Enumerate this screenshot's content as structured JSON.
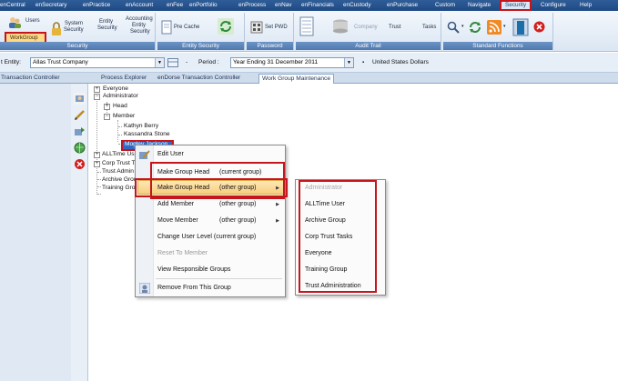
{
  "menu": {
    "tabs": [
      "enCentral",
      "enSecretary",
      "enPractice",
      "enAccount",
      "enFee",
      "enPortfolio",
      "enProcess",
      "enNav",
      "enFinancials",
      "enCustody",
      "enPurchase",
      "Custom",
      "Navigate",
      "Security",
      "Configure",
      "Help"
    ],
    "active": "Security"
  },
  "ribbon": {
    "security": {
      "title": "Security",
      "users": "Users",
      "workgroup": "WorkGroup",
      "system_security_1": "System",
      "system_security_2": "Security",
      "entity_security_1": "Entity",
      "entity_security_2": "Security",
      "accounting_1": "Accounting",
      "accounting_2": "Entity",
      "accounting_3": "Security"
    },
    "entity_security": {
      "title": "Entity Security",
      "pre_cache": "Pre Cache"
    },
    "password": {
      "title": "Password",
      "set_pwd": "Set PWD"
    },
    "audit_trail": {
      "title": "Audit Trail",
      "company": "Company",
      "trust": "Trust",
      "tasks": "Tasks"
    },
    "standard_functions": {
      "title": "Standard Functions"
    }
  },
  "entity_bar": {
    "entity_label": "t Entity:",
    "entity_value": "Allas Trust Company",
    "period_label": "Period :",
    "period_value": "Year Ending 31 December 2011",
    "currency": "United States Dollars",
    "sep": "-"
  },
  "doc_tabs": [
    "Transaction Controller",
    "Process Explorer",
    "enDorse Transaction Controller",
    "Work Group Maintenance"
  ],
  "tree": {
    "everyone": "Everyone",
    "administrator": "Administrator",
    "head": "Head",
    "member": "Member",
    "kathyn": "Kathyn Berry",
    "kassandra": "Kassandra Stone",
    "selected": "Mogley Jackson",
    "alltime": "ALLTime Us",
    "corp": "Corp Trust T",
    "trust_admin": "Trust Admin",
    "archive": "Archive Grou",
    "training": "Training Gro"
  },
  "context_menu": {
    "edit_user": "Edit User",
    "make_head_current": "Make Group Head",
    "make_head_current_r": "(current group)",
    "make_head_other": "Make Group Head",
    "make_head_other_r": "(other group)",
    "add_member": "Add Member",
    "add_member_r": "(other group)",
    "move_member": "Move Member",
    "move_member_r": "(other group)",
    "change_level": "Change User Level (current group)",
    "reset": "Reset To Member",
    "view_resp": "View Responsible Groups",
    "remove": "Remove From This Group"
  },
  "submenu": {
    "items": [
      "Administrator",
      "ALLTime User",
      "Archive Group",
      "Corp Trust Tasks",
      "Everyone",
      "Training Group",
      "Trust Administration"
    ]
  },
  "colors": {
    "accent_red": "#c4161c",
    "ribbon_blue": "#4f78ae",
    "selection_blue": "#316ac5"
  }
}
